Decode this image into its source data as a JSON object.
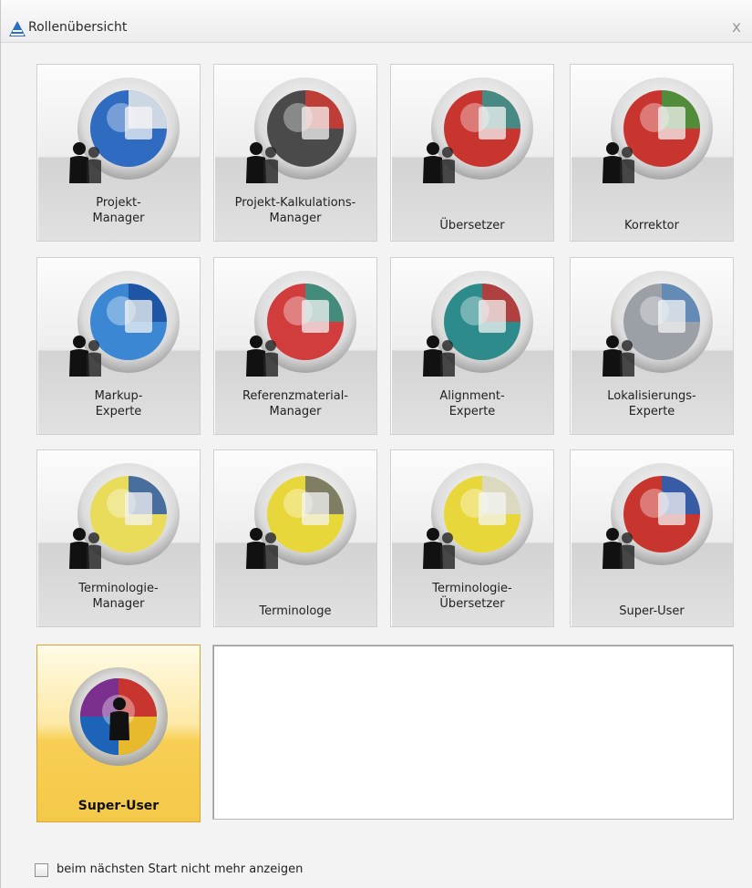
{
  "window": {
    "title": "Rollenübersicht",
    "close_glyph": "x"
  },
  "roles": [
    {
      "label_line1": "Projekt-",
      "label_line2": "Manager",
      "icon": "project-manager-icon"
    },
    {
      "label_line1": "Projekt-Kalkulations-",
      "label_line2": "Manager",
      "icon": "calculation-manager-icon"
    },
    {
      "label_line1": "Übersetzer",
      "label_line2": "",
      "icon": "translator-icon"
    },
    {
      "label_line1": "Korrektor",
      "label_line2": "",
      "icon": "proofreader-icon"
    },
    {
      "label_line1": "Markup-",
      "label_line2": "Experte",
      "icon": "markup-expert-icon"
    },
    {
      "label_line1": "Referenzmaterial-",
      "label_line2": "Manager",
      "icon": "reference-material-manager-icon"
    },
    {
      "label_line1": "Alignment-",
      "label_line2": "Experte",
      "icon": "alignment-expert-icon"
    },
    {
      "label_line1": "Lokalisierungs-",
      "label_line2": "Experte",
      "icon": "localization-expert-icon"
    },
    {
      "label_line1": "Terminologie-",
      "label_line2": "Manager",
      "icon": "terminology-manager-icon"
    },
    {
      "label_line1": "Terminologe",
      "label_line2": "",
      "icon": "terminologist-icon"
    },
    {
      "label_line1": "Terminologie-",
      "label_line2": "Übersetzer",
      "icon": "terminology-translator-icon"
    },
    {
      "label_line1": "Super-User",
      "label_line2": "",
      "icon": "super-user-icon"
    }
  ],
  "selected_role": {
    "label": "Super-User",
    "icon": "super-user-icon"
  },
  "description": "",
  "footer": {
    "checkbox_label": "beim nächsten Start nicht mehr anzeigen",
    "checked": false
  },
  "colors": {
    "selected_tile": "#f7cf54",
    "tile_bg": "#ededed",
    "title_bg": "#f5f5f5"
  }
}
